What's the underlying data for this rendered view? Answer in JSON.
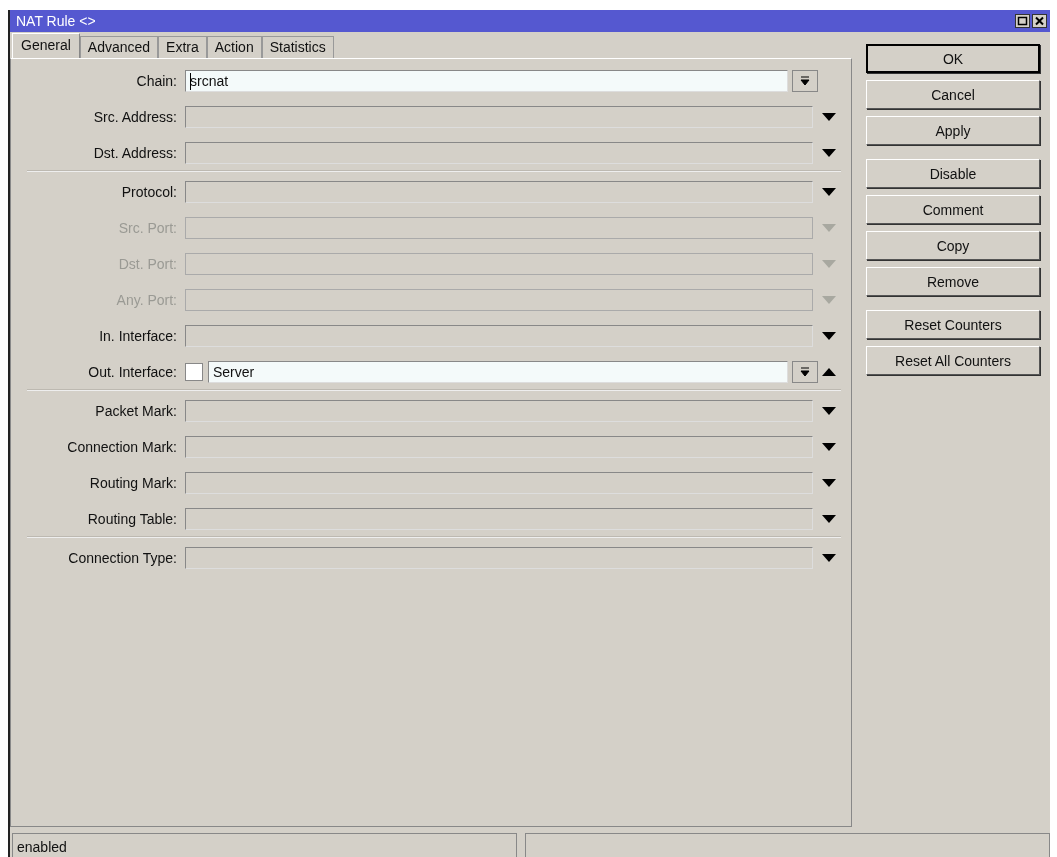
{
  "window": {
    "title": "NAT Rule <>"
  },
  "tabs": [
    {
      "label": "General",
      "selected": true
    },
    {
      "label": "Advanced",
      "selected": false
    },
    {
      "label": "Extra",
      "selected": false
    },
    {
      "label": "Action",
      "selected": false
    },
    {
      "label": "Statistics",
      "selected": false
    }
  ],
  "field_groups": [
    [
      {
        "label": "Chain:",
        "kind": "combo",
        "value": "srcnat",
        "disabled": false
      },
      {
        "label": "Src. Address:",
        "kind": "dropdown",
        "disabled": false
      },
      {
        "label": "Dst. Address:",
        "kind": "dropdown",
        "disabled": false
      }
    ],
    [
      {
        "label": "Protocol:",
        "kind": "dropdown",
        "disabled": false
      },
      {
        "label": "Src. Port:",
        "kind": "dropdown",
        "disabled": true
      },
      {
        "label": "Dst. Port:",
        "kind": "dropdown",
        "disabled": true
      },
      {
        "label": "Any. Port:",
        "kind": "dropdown",
        "disabled": true
      },
      {
        "label": "In. Interface:",
        "kind": "dropdown",
        "disabled": false
      },
      {
        "label": "Out. Interface:",
        "kind": "interface",
        "value": "Server",
        "checked": false,
        "disabled": false
      }
    ],
    [
      {
        "label": "Packet Mark:",
        "kind": "dropdown",
        "disabled": false
      },
      {
        "label": "Connection Mark:",
        "kind": "dropdown",
        "disabled": false
      },
      {
        "label": "Routing Mark:",
        "kind": "dropdown",
        "disabled": false
      },
      {
        "label": "Routing Table:",
        "kind": "dropdown",
        "disabled": false
      }
    ],
    [
      {
        "label": "Connection Type:",
        "kind": "dropdown",
        "disabled": false
      }
    ]
  ],
  "button_groups": [
    [
      "OK",
      "Cancel",
      "Apply"
    ],
    [
      "Disable",
      "Comment",
      "Copy",
      "Remove"
    ],
    [
      "Reset Counters",
      "Reset All Counters"
    ]
  ],
  "status_bar": {
    "text": "enabled"
  }
}
